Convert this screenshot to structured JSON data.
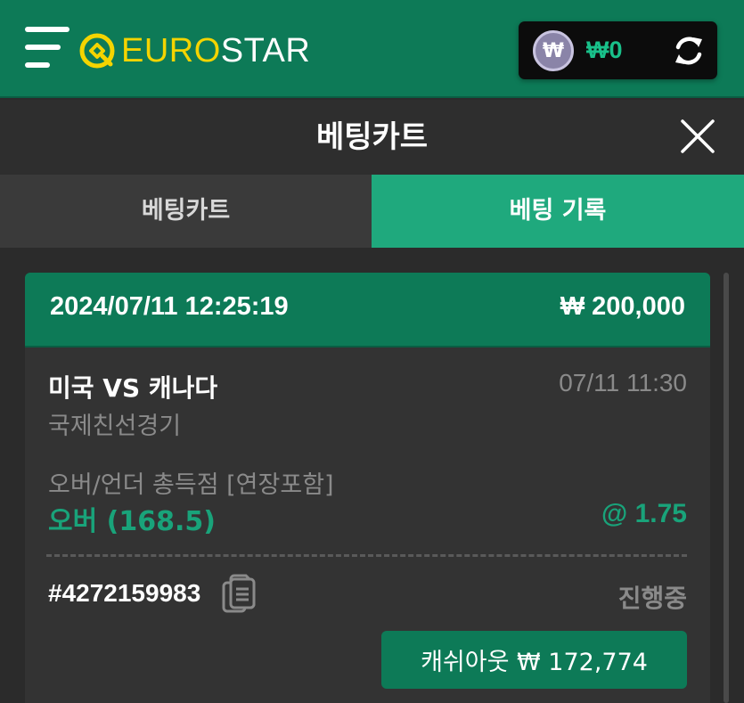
{
  "header": {
    "logo_prefix": "EURO",
    "logo_suffix": "STAR",
    "wallet": {
      "coin_symbol": "₩",
      "balance": "₩0"
    },
    "icons": {
      "menu": "hamburger-menu-icon",
      "refresh": "refresh-icon"
    }
  },
  "cart": {
    "title": "베팅카트",
    "close_icon": "close-icon",
    "tabs": [
      {
        "label": "베팅카트",
        "active": false
      },
      {
        "label": "베팅 기록",
        "active": true
      }
    ]
  },
  "bet": {
    "datetime": "2024/07/11 12:25:19",
    "amount": "₩ 200,000",
    "match": "미국 VS 캐나다",
    "match_time": "07/11 11:30",
    "league": "국제친선경기",
    "market": "오버/언더 총득점 [연장포함]",
    "selection": "오버 (168.5)",
    "odds": "@ 1.75",
    "ticket_id": "#4272159983",
    "status": "진행중",
    "cashout_label": "캐쉬아웃 ₩ 172,774"
  },
  "colors": {
    "brand_green": "#0d7a57",
    "accent_green": "#1fa97d",
    "logo_yellow": "#f4d400",
    "odds_green": "#19a37a"
  }
}
